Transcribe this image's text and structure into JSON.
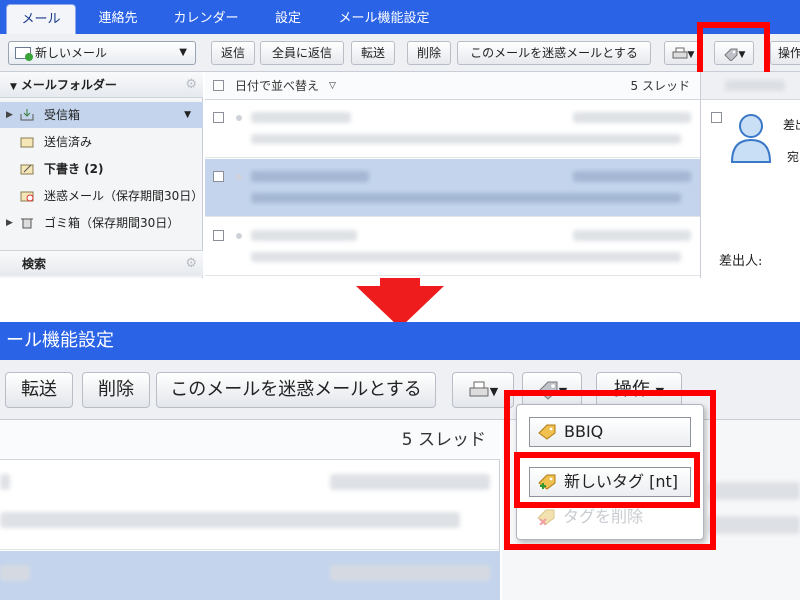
{
  "top": {
    "nav_tabs": [
      {
        "label": "メール",
        "active": true
      },
      {
        "label": "連絡先",
        "active": false
      },
      {
        "label": "カレンダー",
        "active": false
      },
      {
        "label": "設定",
        "active": false
      },
      {
        "label": "メール機能設定",
        "active": false
      }
    ],
    "toolbar": {
      "new_mail": "新しいメール",
      "reply": "返信",
      "reply_all": "全員に返信",
      "forward": "転送",
      "delete": "削除",
      "mark_spam": "このメールを迷惑メールとする",
      "operations": "操作"
    },
    "folders": {
      "header": "メールフォルダー",
      "items": [
        {
          "label": "受信箱",
          "icon": "inbox-icon",
          "selected": true
        },
        {
          "label": "送信済み",
          "icon": "sent-icon",
          "selected": false
        },
        {
          "label": "下書き (2)",
          "icon": "draft-icon",
          "selected": false
        },
        {
          "label": "迷惑メール（保存期間30日）",
          "icon": "spam-icon",
          "selected": false
        },
        {
          "label": "ゴミ箱（保存期間30日）",
          "icon": "trash-icon",
          "selected": false
        }
      ],
      "search": "検索"
    },
    "list": {
      "sort_label": "日付で並べ替え",
      "thread_count": "5 スレッド"
    },
    "preview": {
      "sender_label": "差出人:",
      "partial_text_1": "差出",
      "partial_text_2": "宛"
    }
  },
  "bottom": {
    "title": "ール機能設定",
    "toolbar": {
      "forward": "転送",
      "delete": "削除",
      "mark_spam": "このメールを迷惑メールとする",
      "operations": "操作"
    },
    "list": {
      "thread_count": "5 スレッド"
    },
    "tag_menu": {
      "items": [
        {
          "label": "BBIQ",
          "icon": "tag-icon",
          "disabled": false
        },
        {
          "label": "新しいタグ [nt]",
          "icon": "new-tag-icon",
          "disabled": false
        },
        {
          "label": "タグを削除",
          "icon": "remove-tag-icon",
          "disabled": true
        }
      ]
    }
  },
  "colors": {
    "nav_blue": "#2a63e6",
    "highlight_red": "#ff0000",
    "selected_row": "#c3d4ec",
    "toolbar_bg": "#eef0f3"
  }
}
